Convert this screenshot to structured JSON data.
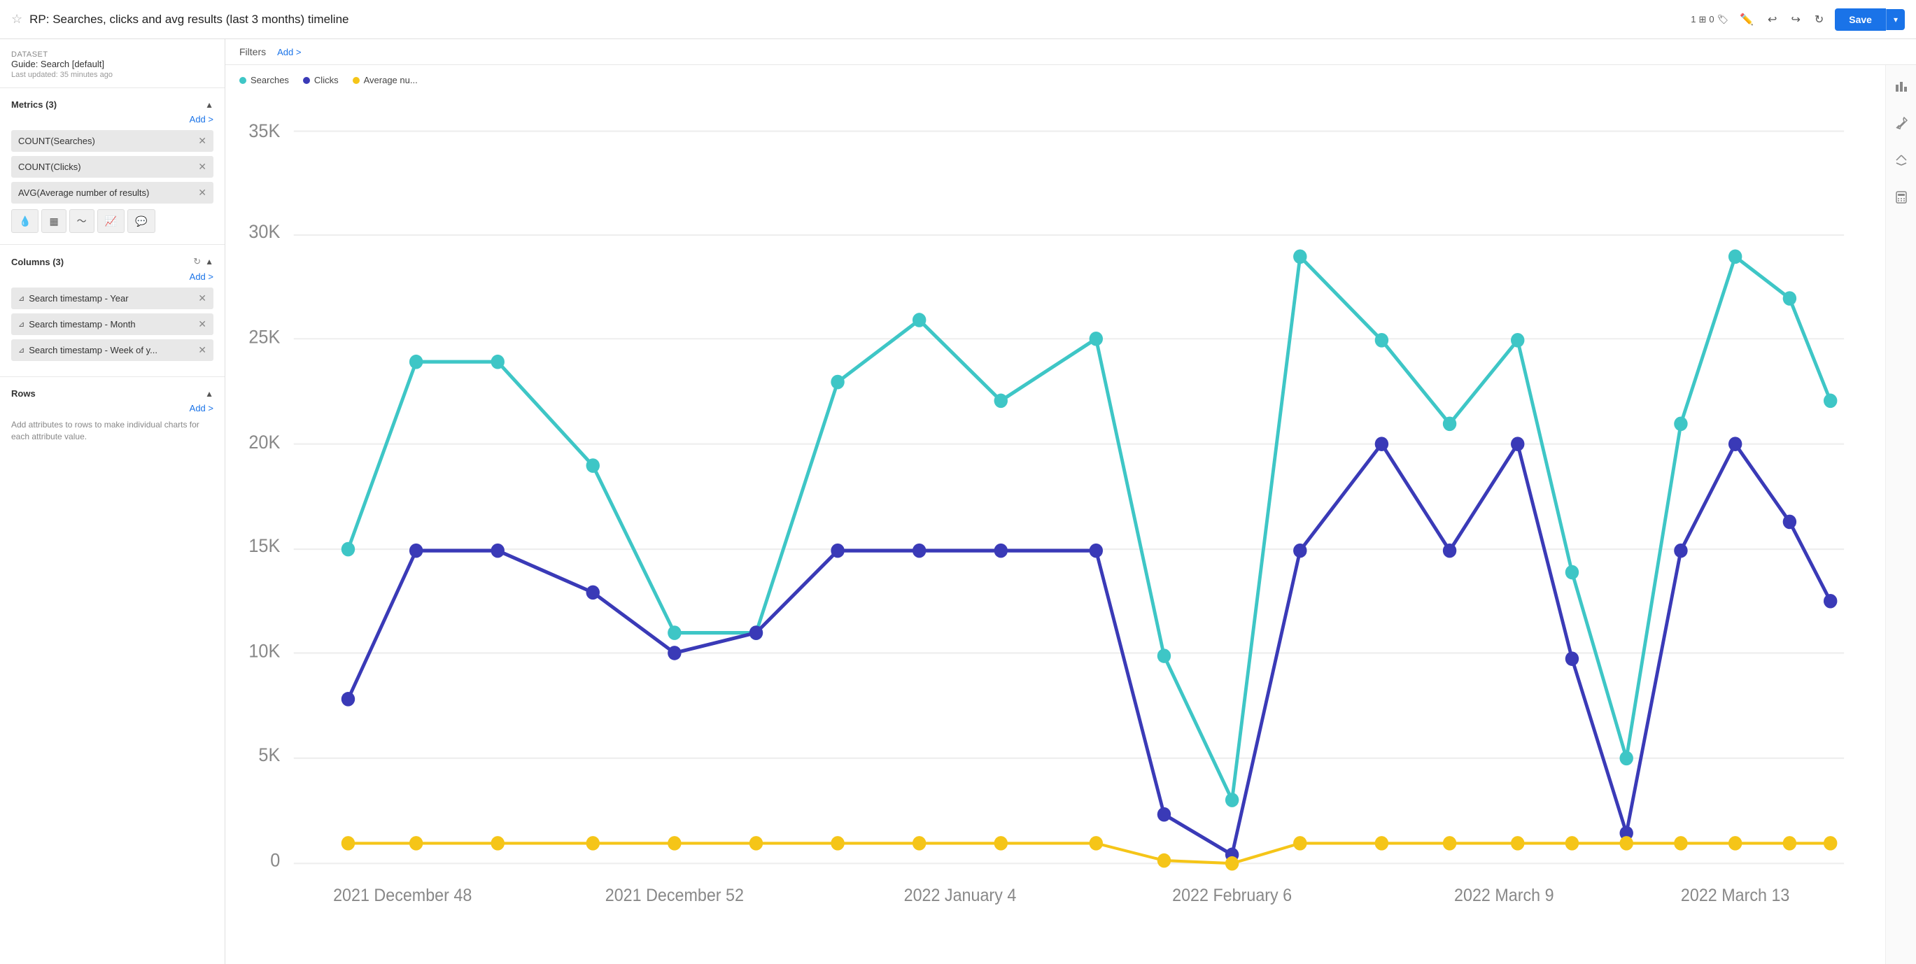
{
  "header": {
    "title": "RP: Searches, clicks and avg results (last 3 months) timeline",
    "badge_count": "1",
    "badge_tag_count": "0",
    "save_label": "Save"
  },
  "dataset": {
    "label": "Dataset",
    "name": "Guide: Search [default]",
    "updated": "Last updated: 35 minutes ago"
  },
  "metrics_section": {
    "title": "Metrics (3)",
    "add_label": "Add >",
    "items": [
      {
        "label": "COUNT(Searches)"
      },
      {
        "label": "COUNT(Clicks)"
      },
      {
        "label": "AVG(Average number of results)"
      }
    ]
  },
  "columns_section": {
    "title": "Columns (3)",
    "add_label": "Add >",
    "items": [
      {
        "label": "Search timestamp - Year"
      },
      {
        "label": "Search timestamp - Month"
      },
      {
        "label": "Search timestamp - Week of y..."
      }
    ]
  },
  "rows_section": {
    "title": "Rows",
    "add_label": "Add >",
    "hint": "Add attributes to rows to make individual charts for each attribute value."
  },
  "filters": {
    "label": "Filters",
    "add_label": "Add >"
  },
  "legend": {
    "items": [
      {
        "label": "Searches",
        "color": "#3ec6c6"
      },
      {
        "label": "Clicks",
        "color": "#3a3ab7"
      },
      {
        "label": "Average nu...",
        "color": "#f5c518"
      }
    ]
  },
  "chart": {
    "y_labels": [
      "35K",
      "30K",
      "25K",
      "20K",
      "15K",
      "10K",
      "5K",
      "0"
    ],
    "x_labels": [
      "2021 December 48",
      "2021 December 52",
      "2022 January 4",
      "2022 February 6",
      "2022 March 9",
      "2022 March 13"
    ]
  },
  "right_panel": {
    "icons": [
      "bar-chart",
      "eyedropper",
      "sort",
      "calculator"
    ]
  }
}
